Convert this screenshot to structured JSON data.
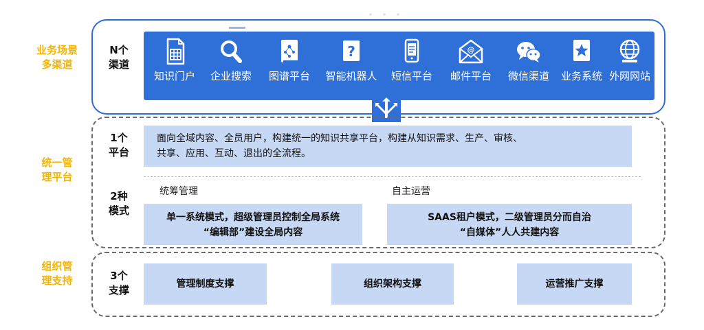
{
  "side_labels": {
    "scenes": [
      "业务场景",
      "多渠道"
    ],
    "platform": [
      "统一管",
      "理平台"
    ],
    "support": [
      "组织管",
      "理支持"
    ]
  },
  "rows": {
    "channels": [
      "N个",
      "渠道"
    ],
    "platform": [
      "1个",
      "平台"
    ],
    "modes": [
      "2种",
      "模式"
    ],
    "support": [
      "3个",
      "支撑"
    ]
  },
  "channels": [
    {
      "label": "知识门户",
      "icon": "portal-document-icon"
    },
    {
      "label": "企业搜索",
      "icon": "search-icon"
    },
    {
      "label": "图谱平台",
      "icon": "graph-book-icon"
    },
    {
      "label": "智能机器人",
      "icon": "question-robot-icon"
    },
    {
      "label": "短信平台",
      "icon": "phone-sms-icon"
    },
    {
      "label": "邮件平台",
      "icon": "mail-icon"
    },
    {
      "label": "微信渠道",
      "icon": "wechat-icon"
    },
    {
      "label": "业务系统",
      "icon": "star-box-icon"
    },
    {
      "label": "外网网站",
      "icon": "globe-icon"
    }
  ],
  "platform_text": [
    "面向全域内容、全员用户，构建统一的知识共享平台，构建从知识需求、生产、审核、",
    "共享、应用、互动、退出的全流程。"
  ],
  "modes": {
    "left": {
      "title": "统筹管理",
      "lines": [
        "单一系统模式，超级管理员控制全局系统",
        "“编辑部”建设全局内容"
      ]
    },
    "right": {
      "title": "自主运营",
      "lines": [
        "SAAS租户模式，二级管理员分而自治",
        "“自媒体”人人共建内容"
      ]
    }
  },
  "supports": [
    "管理制度支撑",
    "组织架构支撑",
    "运营推广支撑"
  ],
  "colors": {
    "accent_yellow": "#f4b400",
    "band_blue": "#2f6fd8",
    "pale_blue": "#c7d8f4",
    "border_blue": "#2e6bd3"
  }
}
